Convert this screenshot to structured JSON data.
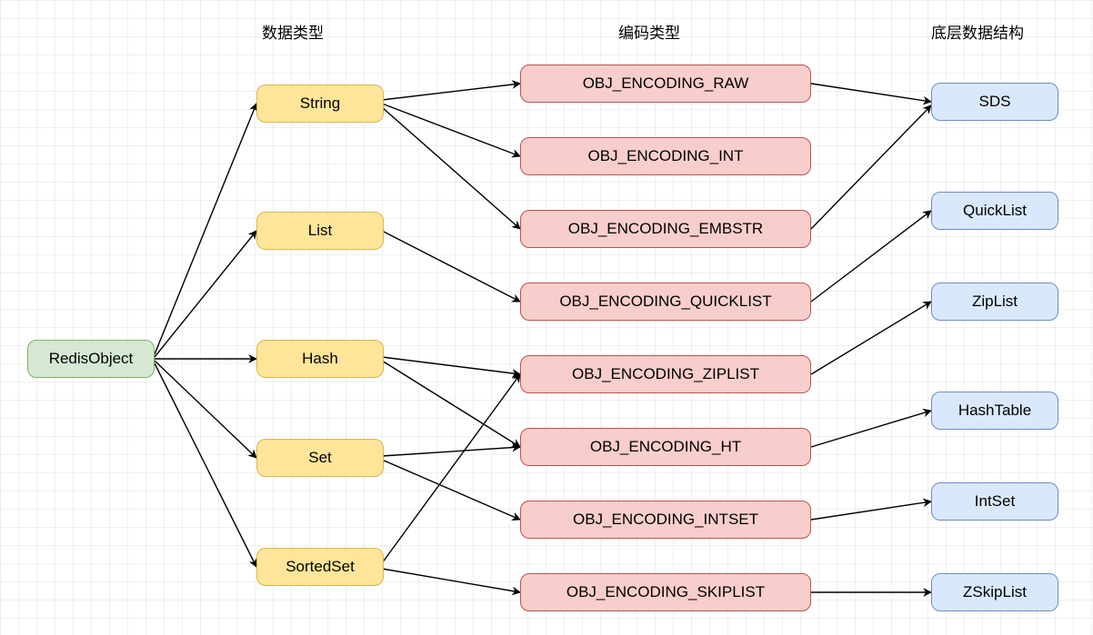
{
  "headers": {
    "col1": "数据类型",
    "col2": "编码类型",
    "col3": "底层数据结构"
  },
  "root": {
    "label": "RedisObject"
  },
  "types": {
    "string": {
      "label": "String"
    },
    "list": {
      "label": "List"
    },
    "hash": {
      "label": "Hash"
    },
    "set": {
      "label": "Set"
    },
    "sortedset": {
      "label": "SortedSet"
    }
  },
  "encodings": {
    "raw": {
      "label": "OBJ_ENCODING_RAW"
    },
    "int": {
      "label": "OBJ_ENCODING_INT"
    },
    "embstr": {
      "label": "OBJ_ENCODING_EMBSTR"
    },
    "quicklist": {
      "label": "OBJ_ENCODING_QUICKLIST"
    },
    "ziplist": {
      "label": "OBJ_ENCODING_ZIPLIST"
    },
    "ht": {
      "label": "OBJ_ENCODING_HT"
    },
    "intset": {
      "label": "OBJ_ENCODING_INTSET"
    },
    "skiplist": {
      "label": "OBJ_ENCODING_SKIPLIST"
    }
  },
  "structures": {
    "sds": {
      "label": "SDS"
    },
    "quicklist": {
      "label": "QuickList"
    },
    "ziplist": {
      "label": "ZipList"
    },
    "hashtable": {
      "label": "HashTable"
    },
    "intset": {
      "label": "IntSet"
    },
    "zskiplist": {
      "label": "ZSkipList"
    }
  },
  "chart_data": {
    "type": "diagram",
    "title": "Redis Object → Encoding → Data Structure mapping",
    "columns": [
      "数据类型",
      "编码类型",
      "底层数据结构"
    ],
    "root": "RedisObject",
    "data_types": [
      "String",
      "List",
      "Hash",
      "Set",
      "SortedSet"
    ],
    "encodings": [
      "OBJ_ENCODING_RAW",
      "OBJ_ENCODING_INT",
      "OBJ_ENCODING_EMBSTR",
      "OBJ_ENCODING_QUICKLIST",
      "OBJ_ENCODING_ZIPLIST",
      "OBJ_ENCODING_HT",
      "OBJ_ENCODING_INTSET",
      "OBJ_ENCODING_SKIPLIST"
    ],
    "structures": [
      "SDS",
      "QuickList",
      "ZipList",
      "HashTable",
      "IntSet",
      "ZSkipList"
    ],
    "edges_root_to_type": [
      [
        "RedisObject",
        "String"
      ],
      [
        "RedisObject",
        "List"
      ],
      [
        "RedisObject",
        "Hash"
      ],
      [
        "RedisObject",
        "Set"
      ],
      [
        "RedisObject",
        "SortedSet"
      ]
    ],
    "edges_type_to_encoding": [
      [
        "String",
        "OBJ_ENCODING_RAW"
      ],
      [
        "String",
        "OBJ_ENCODING_INT"
      ],
      [
        "String",
        "OBJ_ENCODING_EMBSTR"
      ],
      [
        "List",
        "OBJ_ENCODING_QUICKLIST"
      ],
      [
        "Hash",
        "OBJ_ENCODING_ZIPLIST"
      ],
      [
        "Hash",
        "OBJ_ENCODING_HT"
      ],
      [
        "Set",
        "OBJ_ENCODING_HT"
      ],
      [
        "Set",
        "OBJ_ENCODING_INTSET"
      ],
      [
        "SortedSet",
        "OBJ_ENCODING_ZIPLIST"
      ],
      [
        "SortedSet",
        "OBJ_ENCODING_SKIPLIST"
      ]
    ],
    "edges_encoding_to_structure": [
      [
        "OBJ_ENCODING_RAW",
        "SDS"
      ],
      [
        "OBJ_ENCODING_EMBSTR",
        "SDS"
      ],
      [
        "OBJ_ENCODING_QUICKLIST",
        "QuickList"
      ],
      [
        "OBJ_ENCODING_ZIPLIST",
        "ZipList"
      ],
      [
        "OBJ_ENCODING_HT",
        "HashTable"
      ],
      [
        "OBJ_ENCODING_INTSET",
        "IntSet"
      ],
      [
        "OBJ_ENCODING_SKIPLIST",
        "ZSkipList"
      ]
    ]
  }
}
